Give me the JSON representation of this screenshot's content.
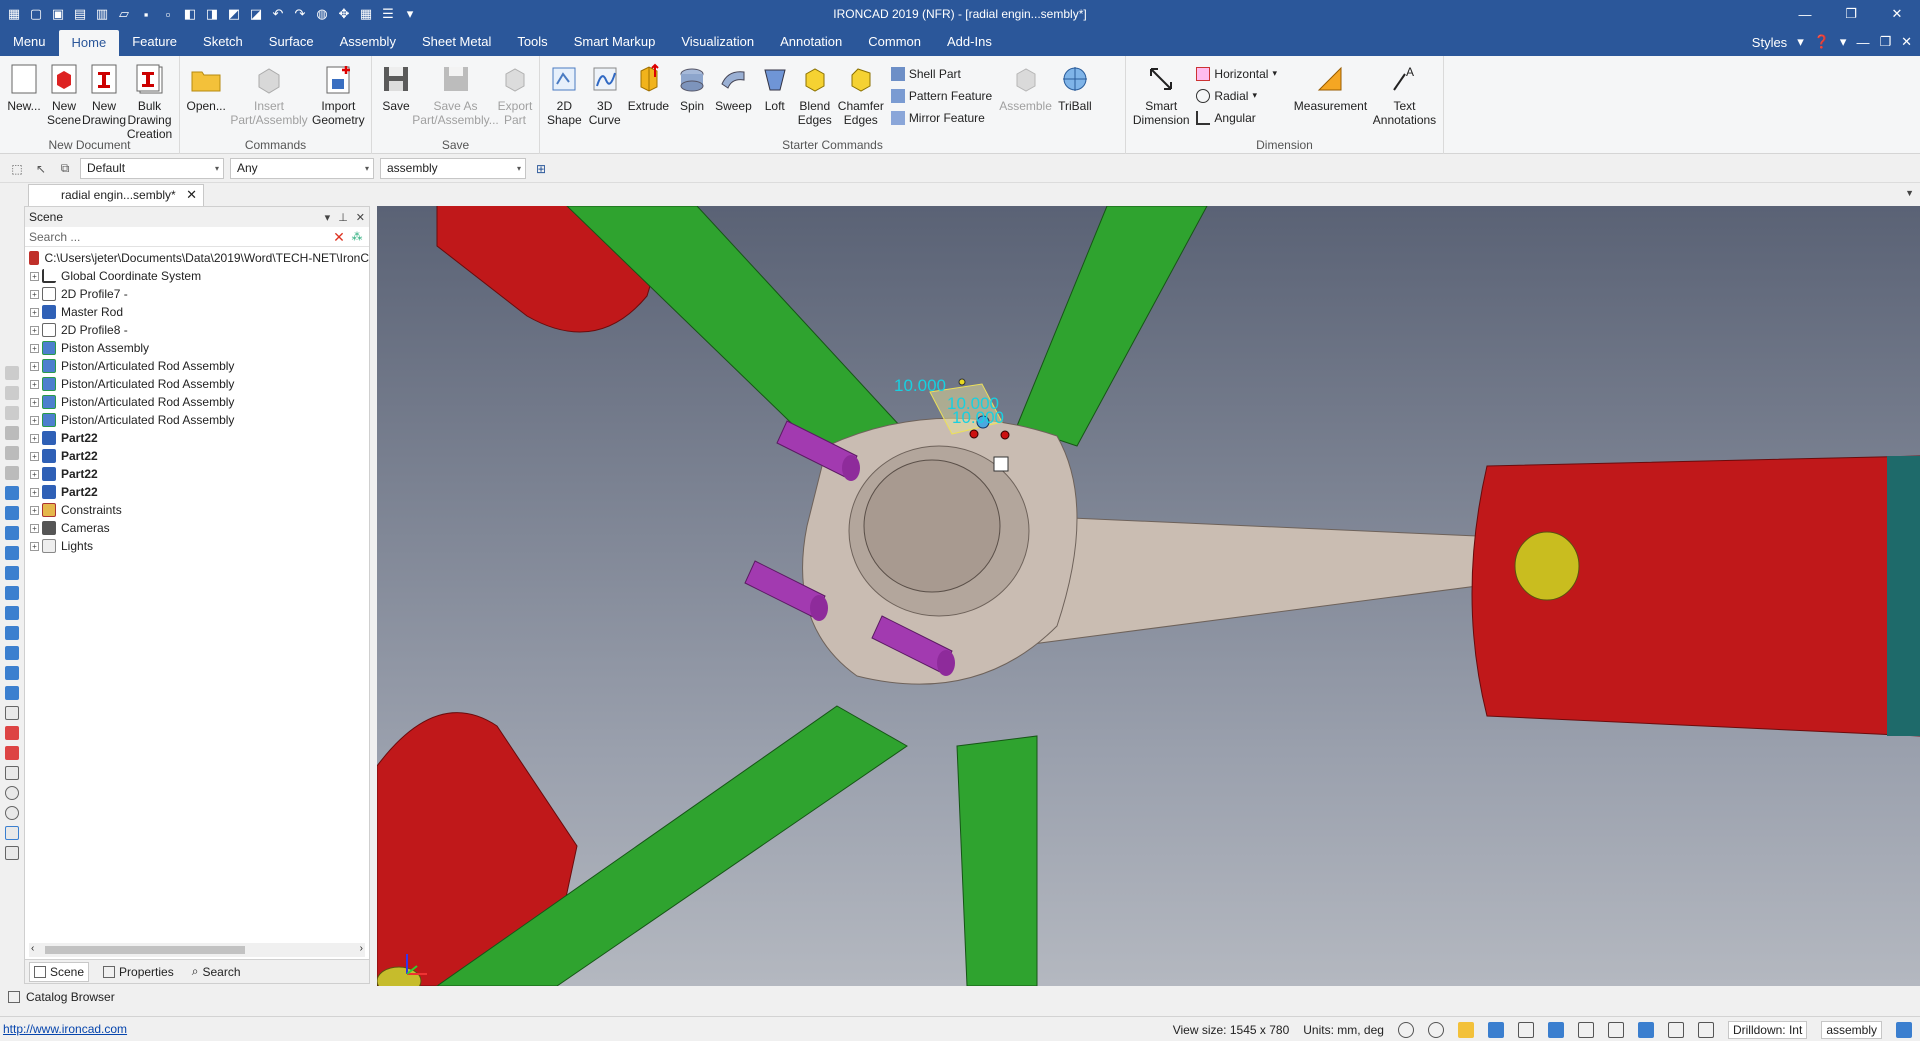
{
  "window": {
    "title": "IRONCAD 2019 (NFR) - [radial engin...sembly*]"
  },
  "menu_tabs": [
    "Menu",
    "Home",
    "Feature",
    "Sketch",
    "Surface",
    "Assembly",
    "Sheet Metal",
    "Tools",
    "Smart Markup",
    "Visualization",
    "Annotation",
    "Common",
    "Add-Ins"
  ],
  "active_tab": "Home",
  "styles_label": "Styles",
  "ribbon": {
    "new_document": {
      "label": "New Document",
      "buttons": [
        "New...",
        "New\nScene",
        "New\nDrawing",
        "Bulk Drawing\nCreation"
      ]
    },
    "commands": {
      "label": "Commands",
      "buttons": [
        "Open...",
        "Insert\nPart/Assembly",
        "Import\nGeometry"
      ]
    },
    "save": {
      "label": "Save",
      "buttons": [
        "Save",
        "Save As\nPart/Assembly...",
        "Export\nPart"
      ]
    },
    "starter": {
      "label": "Starter Commands",
      "buttons": [
        "2D\nShape",
        "3D\nCurve",
        "Extrude",
        "Spin",
        "Sweep",
        "Loft",
        "Blend\nEdges",
        "Chamfer\nEdges"
      ],
      "small": [
        "Shell Part",
        "Pattern Feature",
        "Mirror Feature"
      ],
      "more": [
        "Assemble",
        "TriBall"
      ]
    },
    "dimension": {
      "label": "Dimension",
      "big_left": "Smart\nDimension",
      "small": [
        "Horizontal",
        "Radial",
        "Angular"
      ],
      "buttons": [
        "Measurement",
        "Text\nAnnotations"
      ]
    }
  },
  "toolbar": {
    "style_combo": "Default",
    "filter_combo": "Any",
    "level_combo": "assembly"
  },
  "doc_tab": {
    "label": "radial engin...sembly*"
  },
  "scene_panel": {
    "title": "Scene",
    "search_placeholder": "Search ...",
    "root": "C:\\Users\\jeter\\Documents\\Data\\2019\\Word\\TECH-NET\\IronC",
    "items": [
      {
        "label": "Global Coordinate System",
        "icon": "coordinate-system-icon",
        "bold": false
      },
      {
        "label": "2D Profile7 -",
        "icon": "profile-icon",
        "bold": false
      },
      {
        "label": "Master Rod",
        "icon": "part-icon",
        "bold": false
      },
      {
        "label": "2D Profile8 -",
        "icon": "profile-icon",
        "bold": false
      },
      {
        "label": "Piston Assembly",
        "icon": "assembly-icon",
        "bold": false
      },
      {
        "label": "Piston/Articulated Rod Assembly",
        "icon": "assembly-icon",
        "bold": false
      },
      {
        "label": "Piston/Articulated Rod Assembly",
        "icon": "assembly-icon",
        "bold": false
      },
      {
        "label": "Piston/Articulated Rod Assembly",
        "icon": "assembly-icon",
        "bold": false
      },
      {
        "label": "Piston/Articulated Rod Assembly",
        "icon": "assembly-icon",
        "bold": false
      },
      {
        "label": "Part22",
        "icon": "part-icon",
        "bold": true
      },
      {
        "label": "Part22",
        "icon": "part-icon",
        "bold": true
      },
      {
        "label": "Part22",
        "icon": "part-icon",
        "bold": true
      },
      {
        "label": "Part22",
        "icon": "part-icon",
        "bold": true
      },
      {
        "label": "Constraints",
        "icon": "constraints-icon",
        "bold": false
      },
      {
        "label": "Cameras",
        "icon": "camera-icon",
        "bold": false
      },
      {
        "label": "Lights",
        "icon": "light-icon",
        "bold": false
      }
    ],
    "tabs": [
      "Scene",
      "Properties",
      "Search"
    ]
  },
  "viewport": {
    "dimension_labels": [
      "10.000",
      "10.000",
      "10.000"
    ]
  },
  "catalog_browser": "Catalog Browser",
  "status": {
    "link": "http://www.ironcad.com",
    "view_size": "View size: 1545 x 780",
    "units": "Units: mm, deg",
    "drilldown": "Drilldown: Int",
    "level": "assembly"
  },
  "colors": {
    "titlebar": "#2b579a",
    "piston_red": "#c8181a",
    "rod_green": "#2aa52a",
    "hub_tan": "#c9bcb2",
    "pin_purple": "#a33ab0"
  }
}
